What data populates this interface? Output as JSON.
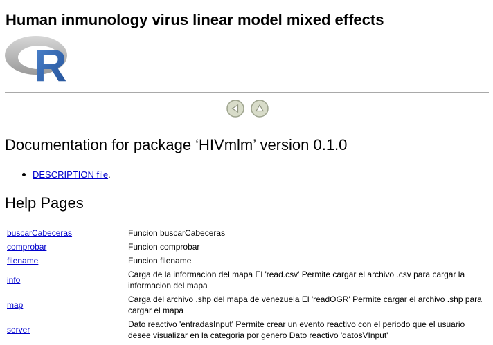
{
  "page": {
    "title": "Human inmunology virus linear model mixed effects",
    "logo_letter": "R",
    "logo_colors": {
      "ring": "#a8a8a8",
      "letter": "#2e67b3"
    }
  },
  "nav": {
    "buttons": [
      {
        "icon": "left-arrow-icon"
      },
      {
        "icon": "up-arrow-icon"
      }
    ]
  },
  "documentation": {
    "heading": "Documentation for package ‘HIVmlm’ version 0.1.0",
    "links": [
      {
        "label": "DESCRIPTION file",
        "suffix": "."
      }
    ]
  },
  "help": {
    "heading": "Help Pages",
    "rows": [
      {
        "name": "buscarCabeceras",
        "description": "Funcion buscarCabeceras"
      },
      {
        "name": "comprobar",
        "description": "Funcion comprobar"
      },
      {
        "name": "filename",
        "description": "Funcion filename"
      },
      {
        "name": "info",
        "description": "Carga de la informacion del mapa El 'read.csv' Permite cargar el archivo .csv para cargar la informacion del mapa"
      },
      {
        "name": "map",
        "description": "Carga del archivo .shp del mapa de venezuela El 'readOGR' Permite cargar el archivo .shp para cargar el mapa"
      },
      {
        "name": "server",
        "description": "Dato reactivo 'entradasInput' Permite crear un evento reactivo con el periodo que el usuario desee visualizar en la categoria por genero Dato reactivo 'datosVInput'"
      }
    ]
  },
  "colors": {
    "link": "#0000cc",
    "rule": "#a9a9a9",
    "nav_button_fill": "#d8dcc9",
    "nav_button_border": "#9ea48e"
  }
}
